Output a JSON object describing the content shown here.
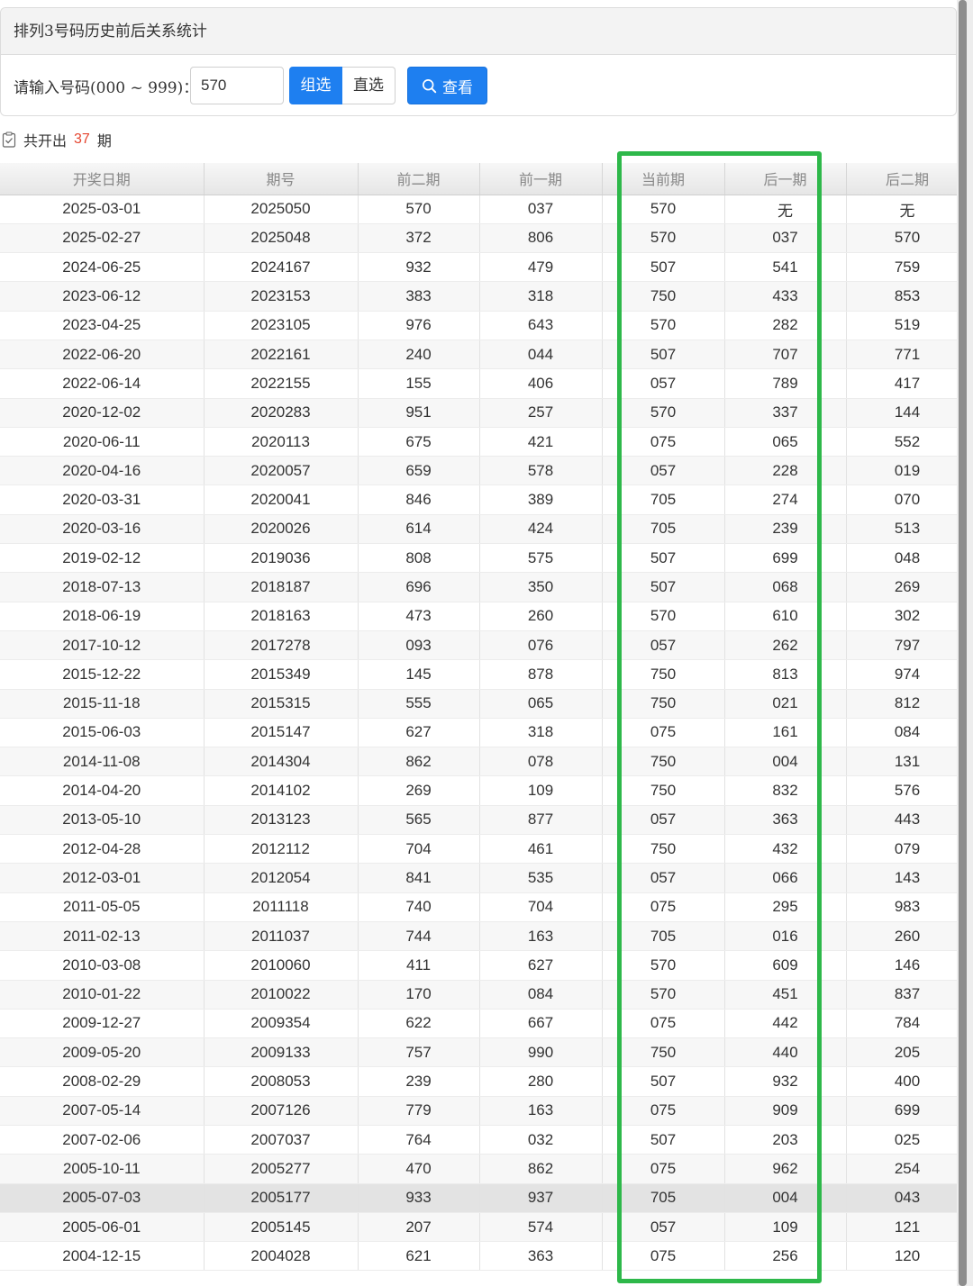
{
  "panel": {
    "title": "排列3号码历史前后关系统计",
    "input_label": "请输入号码(000 ~ 999)：",
    "input_value": "570",
    "seg_group": "组选",
    "seg_direct": "直选",
    "view_button": "查看"
  },
  "summary": {
    "prefix": "共开出",
    "count": "37",
    "suffix": "期"
  },
  "table": {
    "headers": [
      "开奖日期",
      "期号",
      "前二期",
      "前一期",
      "当前期",
      "后一期",
      "后二期"
    ],
    "rows": [
      [
        "2025-03-01",
        "2025050",
        "570",
        "037",
        "570",
        "无",
        "无"
      ],
      [
        "2025-02-27",
        "2025048",
        "372",
        "806",
        "570",
        "037",
        "570"
      ],
      [
        "2024-06-25",
        "2024167",
        "932",
        "479",
        "507",
        "541",
        "759"
      ],
      [
        "2023-06-12",
        "2023153",
        "383",
        "318",
        "750",
        "433",
        "853"
      ],
      [
        "2023-04-25",
        "2023105",
        "976",
        "643",
        "570",
        "282",
        "519"
      ],
      [
        "2022-06-20",
        "2022161",
        "240",
        "044",
        "507",
        "707",
        "771"
      ],
      [
        "2022-06-14",
        "2022155",
        "155",
        "406",
        "057",
        "789",
        "417"
      ],
      [
        "2020-12-02",
        "2020283",
        "951",
        "257",
        "570",
        "337",
        "144"
      ],
      [
        "2020-06-11",
        "2020113",
        "675",
        "421",
        "075",
        "065",
        "552"
      ],
      [
        "2020-04-16",
        "2020057",
        "659",
        "578",
        "057",
        "228",
        "019"
      ],
      [
        "2020-03-31",
        "2020041",
        "846",
        "389",
        "705",
        "274",
        "070"
      ],
      [
        "2020-03-16",
        "2020026",
        "614",
        "424",
        "705",
        "239",
        "513"
      ],
      [
        "2019-02-12",
        "2019036",
        "808",
        "575",
        "507",
        "699",
        "048"
      ],
      [
        "2018-07-13",
        "2018187",
        "696",
        "350",
        "507",
        "068",
        "269"
      ],
      [
        "2018-06-19",
        "2018163",
        "473",
        "260",
        "570",
        "610",
        "302"
      ],
      [
        "2017-10-12",
        "2017278",
        "093",
        "076",
        "057",
        "262",
        "797"
      ],
      [
        "2015-12-22",
        "2015349",
        "145",
        "878",
        "750",
        "813",
        "974"
      ],
      [
        "2015-11-18",
        "2015315",
        "555",
        "065",
        "750",
        "021",
        "812"
      ],
      [
        "2015-06-03",
        "2015147",
        "627",
        "318",
        "075",
        "161",
        "084"
      ],
      [
        "2014-11-08",
        "2014304",
        "862",
        "078",
        "750",
        "004",
        "131"
      ],
      [
        "2014-04-20",
        "2014102",
        "269",
        "109",
        "750",
        "832",
        "576"
      ],
      [
        "2013-05-10",
        "2013123",
        "565",
        "877",
        "057",
        "363",
        "443"
      ],
      [
        "2012-04-28",
        "2012112",
        "704",
        "461",
        "750",
        "432",
        "079"
      ],
      [
        "2012-03-01",
        "2012054",
        "841",
        "535",
        "057",
        "066",
        "143"
      ],
      [
        "2011-05-05",
        "2011118",
        "740",
        "704",
        "075",
        "295",
        "983"
      ],
      [
        "2011-02-13",
        "2011037",
        "744",
        "163",
        "705",
        "016",
        "260"
      ],
      [
        "2010-03-08",
        "2010060",
        "411",
        "627",
        "570",
        "609",
        "146"
      ],
      [
        "2010-01-22",
        "2010022",
        "170",
        "084",
        "570",
        "451",
        "837"
      ],
      [
        "2009-12-27",
        "2009354",
        "622",
        "667",
        "075",
        "442",
        "784"
      ],
      [
        "2009-05-20",
        "2009133",
        "757",
        "990",
        "750",
        "440",
        "205"
      ],
      [
        "2008-02-29",
        "2008053",
        "239",
        "280",
        "507",
        "932",
        "400"
      ],
      [
        "2007-05-14",
        "2007126",
        "779",
        "163",
        "075",
        "909",
        "699"
      ],
      [
        "2007-02-06",
        "2007037",
        "764",
        "032",
        "507",
        "203",
        "025"
      ],
      [
        "2005-10-11",
        "2005277",
        "470",
        "862",
        "075",
        "962",
        "254"
      ],
      [
        "2005-07-03",
        "2005177",
        "933",
        "937",
        "705",
        "004",
        "043"
      ],
      [
        "2005-06-01",
        "2005145",
        "207",
        "574",
        "057",
        "109",
        "121"
      ],
      [
        "2004-12-15",
        "2004028",
        "621",
        "363",
        "075",
        "256",
        "120"
      ]
    ],
    "highlight_row_index": 34
  },
  "colors": {
    "accent": "#1e7ff0",
    "count": "#e5452f",
    "highlight_box": "#2eb84a"
  },
  "icons": {
    "view_button": "search-icon",
    "summary": "clipboard-check-icon"
  }
}
